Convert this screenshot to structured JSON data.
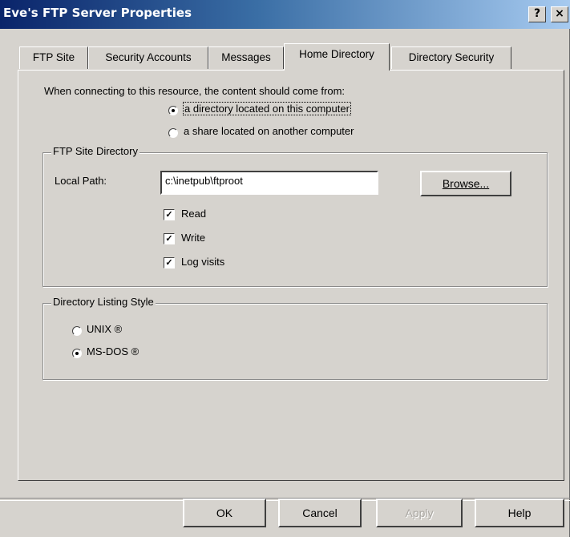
{
  "window": {
    "title": "Eve's FTP Server Properties",
    "help_btn": "?",
    "close_btn": "×"
  },
  "tabs": [
    {
      "label": "FTP Site"
    },
    {
      "label": "Security Accounts"
    },
    {
      "label": "Messages"
    },
    {
      "label": "Home Directory",
      "active": true
    },
    {
      "label": "Directory Security"
    }
  ],
  "home_directory": {
    "source_label": "When connecting to this resource, the content should come from:",
    "source_options": [
      {
        "label": "a directory located on this computer",
        "selected": true
      },
      {
        "label": "a share located on another computer",
        "selected": false
      }
    ],
    "ftp_site_directory": {
      "group_label": "FTP Site Directory",
      "local_path_label": "Local Path:",
      "local_path_value": "c:\\inetpub\\ftproot",
      "browse_label": "Browse...",
      "permissions": [
        {
          "label": "Read",
          "checked": true
        },
        {
          "label": "Write",
          "checked": true
        },
        {
          "label": "Log visits",
          "checked": true
        }
      ]
    },
    "directory_listing_style": {
      "group_label": "Directory Listing Style",
      "options": [
        {
          "label": "UNIX ®",
          "selected": false
        },
        {
          "label": "MS-DOS ®",
          "selected": true
        }
      ]
    }
  },
  "footer": {
    "ok_label": "OK",
    "cancel_label": "Cancel",
    "apply_label": "Apply",
    "help_label": "Help"
  }
}
